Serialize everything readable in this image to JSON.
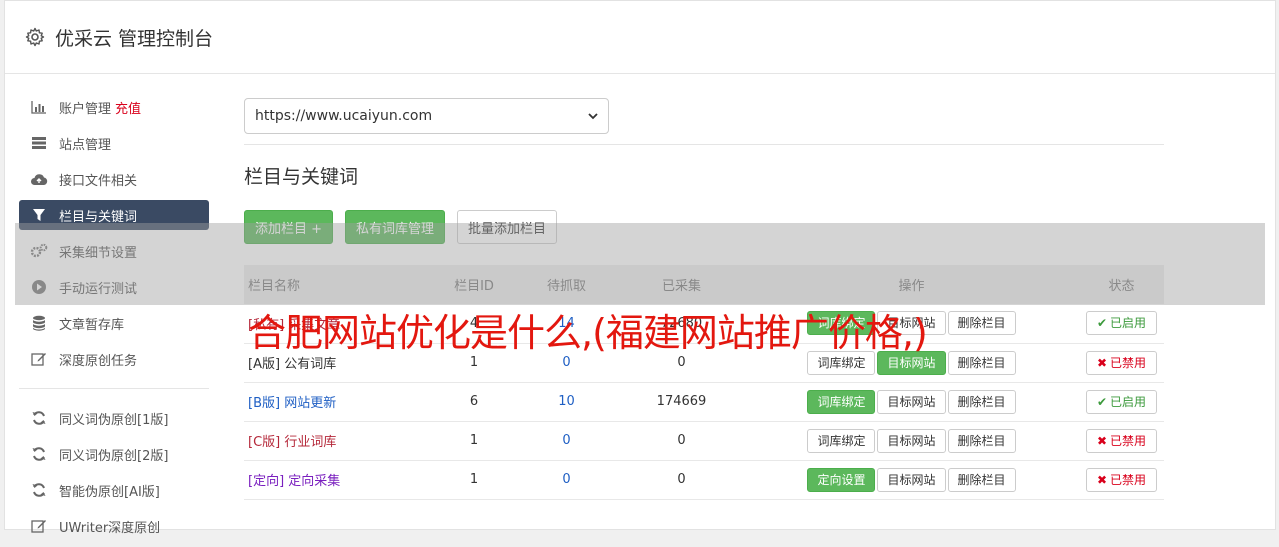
{
  "header": {
    "title": "优采云 管理控制台"
  },
  "sidebar": {
    "items": [
      {
        "label": "账户管理",
        "extra": "充值",
        "icon": "bar-chart-icon",
        "active": false
      },
      {
        "label": "站点管理",
        "icon": "server-icon",
        "active": false
      },
      {
        "label": "接口文件相关",
        "icon": "cloud-upload-icon",
        "active": false
      },
      {
        "label": "栏目与关键词",
        "icon": "filter-icon",
        "active": true
      },
      {
        "label": "采集细节设置",
        "icon": "cogs-icon",
        "active": false
      },
      {
        "label": "手动运行测试",
        "icon": "play-icon",
        "active": false
      },
      {
        "label": "文章暂存库",
        "icon": "database-icon",
        "active": false
      },
      {
        "label": "深度原创任务",
        "icon": "edit-icon",
        "active": false
      }
    ],
    "items2": [
      {
        "label": "同义词伪原创[1版]",
        "icon": "refresh-icon"
      },
      {
        "label": "同义词伪原创[2版]",
        "icon": "refresh-icon"
      },
      {
        "label": "智能伪原创[AI版]",
        "icon": "refresh-icon"
      },
      {
        "label": "UWriter深度原创",
        "icon": "edit-icon"
      }
    ]
  },
  "main": {
    "site_select": "https://www.ucaiyun.com",
    "section_title": "栏目与关键词",
    "buttons": {
      "add": "添加栏目 +",
      "private": "私有词库管理",
      "batch": "批量添加栏目"
    },
    "table": {
      "headers": [
        "栏目名称",
        "栏目ID",
        "待抓取",
        "已采集",
        "操作",
        "状态"
      ],
      "rows": [
        {
          "prefix": "[私有]",
          "name": "采集文章",
          "id": "4",
          "pending": "14",
          "collected": "72680",
          "op1": "词库绑定",
          "op2": "目标网站",
          "op3": "删除栏目",
          "status": "已启用"
        },
        {
          "prefix": "[A版]",
          "name": "公有词库",
          "id": "1",
          "pending": "0",
          "collected": "0",
          "op1": "词库绑定",
          "op2": "目标网站",
          "op3": "删除栏目",
          "status": "已禁用"
        },
        {
          "prefix": "[B版]",
          "name": "网站更新",
          "id": "6",
          "pending": "10",
          "collected": "174669",
          "op1": "词库绑定",
          "op2": "目标网站",
          "op3": "删除栏目",
          "status": "已启用"
        },
        {
          "prefix": "[C版]",
          "name": "行业词库",
          "id": "1",
          "pending": "0",
          "collected": "0",
          "op1": "词库绑定",
          "op2": "目标网站",
          "op3": "删除栏目",
          "status": "已禁用"
        },
        {
          "prefix": "[定向]",
          "name": "定向采集",
          "id": "1",
          "pending": "0",
          "collected": "0",
          "op1": "定向设置",
          "op2": "目标网站",
          "op3": "删除栏目",
          "status": "已禁用"
        }
      ]
    }
  },
  "watermark": "合肥网站优化是什么,(福建网站推广价格,)",
  "colors": {
    "green": "#5cb85c",
    "nav_active": "#3a4a63",
    "red": "#d9001b",
    "blue": "#1f5fc4"
  }
}
